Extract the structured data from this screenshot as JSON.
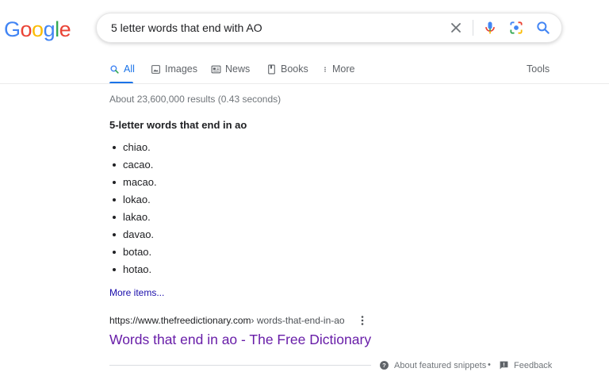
{
  "logo": {
    "letters": [
      "G",
      "o",
      "o",
      "g",
      "l",
      "e"
    ],
    "colors": [
      "#4285F4",
      "#EA4335",
      "#FBBC05",
      "#4285F4",
      "#34A853",
      "#EA4335"
    ]
  },
  "search": {
    "query": "5 letter words that end with AO",
    "icons": [
      "close-icon",
      "microphone-icon",
      "camera-lens-icon",
      "search-icon"
    ]
  },
  "tabs": [
    {
      "label": "All",
      "icon": "search-icon",
      "active": true
    },
    {
      "label": "Images",
      "icon": "image-icon"
    },
    {
      "label": "News",
      "icon": "newspaper-icon"
    },
    {
      "label": "Books",
      "icon": "book-icon"
    },
    {
      "label": "More",
      "icon": "kebab-icon"
    }
  ],
  "tools_label": "Tools",
  "stats": "About 23,600,000 results (0.43 seconds)",
  "snippet": {
    "title": "5-letter words that end in ao",
    "items": [
      "chiao.",
      "cacao.",
      "macao.",
      "lokao.",
      "lakao.",
      "davao.",
      "botao.",
      "hotao."
    ],
    "more_items": "More items..."
  },
  "result": {
    "domain": "https://www.thefreedictionary.com",
    "path": " › words-that-end-in-ao",
    "title": "Words that end in ao - The Free Dictionary"
  },
  "footer": {
    "about_label": "About featured snippets",
    "separator": "•",
    "feedback_label": "Feedback"
  },
  "colors": {
    "accent": "#1a73e8",
    "link": "#1a0dab",
    "visited": "#681da8",
    "muted": "#70757a"
  }
}
